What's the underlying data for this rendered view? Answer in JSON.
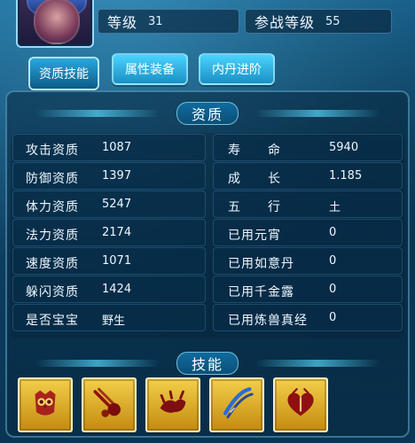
{
  "header": {
    "level_label": "等级",
    "level_value": "31",
    "battle_level_label": "参战等级",
    "battle_level_value": "55"
  },
  "tabs": [
    {
      "label": "资质技能",
      "active": true
    },
    {
      "label": "属性装备",
      "active": false
    },
    {
      "label": "内丹进阶",
      "active": false
    }
  ],
  "sections": {
    "qualifications_title": "资质",
    "skills_title": "技能"
  },
  "qualifications": {
    "left": [
      {
        "label": "攻击资质",
        "value": "1087"
      },
      {
        "label": "防御资质",
        "value": "1397"
      },
      {
        "label": "体力资质",
        "value": "5247"
      },
      {
        "label": "法力资质",
        "value": "2174"
      },
      {
        "label": "速度资质",
        "value": "1071"
      },
      {
        "label": "躲闪资质",
        "value": "1424"
      },
      {
        "label": "是否宝宝",
        "value": "野生"
      }
    ],
    "right": [
      {
        "label": "寿　　命",
        "value": "5940"
      },
      {
        "label": "成　　长",
        "value": "1.185"
      },
      {
        "label": "五　　行",
        "value": "土"
      },
      {
        "label": "已用元宵",
        "value": "0"
      },
      {
        "label": "已用如意丹",
        "value": "0"
      },
      {
        "label": "已用千金露",
        "value": "0"
      },
      {
        "label": "已用炼兽真经",
        "value": "0"
      }
    ]
  },
  "skills": [
    {
      "icon": "owl-icon"
    },
    {
      "icon": "meteor-icon"
    },
    {
      "icon": "beast-icon"
    },
    {
      "icon": "slash-icon"
    },
    {
      "icon": "heart-icon"
    }
  ]
}
